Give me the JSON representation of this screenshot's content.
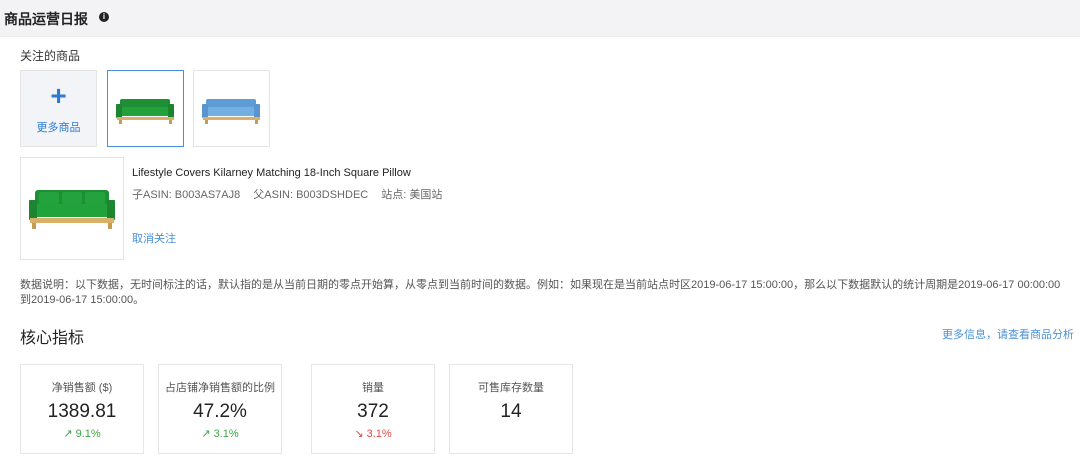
{
  "header": {
    "title": "商品运营日报",
    "info_icon": "info-icon"
  },
  "watchlist": {
    "label": "关注的商品",
    "add_label": "更多商品",
    "items": [
      {
        "icon": "sofa-green-thumbnail",
        "selected": true,
        "color": "#1f9a3a"
      },
      {
        "icon": "sofa-blue-thumbnail",
        "selected": false,
        "color": "#6aa6dd"
      }
    ]
  },
  "product": {
    "title": "Lifestyle Covers Kilarney Matching 18-Inch Square Pillow",
    "child_asin": "子ASIN: B003AS7AJ8",
    "parent_asin": "父ASIN: B003DSHDEC",
    "site": "站点: 美国站",
    "unfollow_label": "取消关注"
  },
  "note": "数据说明：以下数据，无时间标注的话，默认指的是从当前日期的零点开始算，从零点到当前时间的数据。例如：如果现在是当前站点时区2019-06-17 15:00:00，那么以下数据默认的统计周期是2019-06-17 00:00:00到2019-06-17 15:00:00。",
  "metrics": {
    "title": "核心指标",
    "more_link": "更多信息，请查看商品分析",
    "cards": [
      {
        "label": "净销售额 ($)",
        "value": "1389.81",
        "change": "9.1%",
        "direction": "up"
      },
      {
        "label": "占店铺净销售额的比例",
        "value": "47.2%",
        "change": "3.1%",
        "direction": "up"
      },
      {
        "label": "销量",
        "value": "372",
        "change": "3.1%",
        "direction": "down"
      },
      {
        "label": "可售库存数量",
        "value": "14",
        "change": "",
        "direction": ""
      }
    ]
  },
  "colors": {
    "accent": "#4a90d9",
    "up": "#3aa845",
    "down": "#e04848"
  }
}
